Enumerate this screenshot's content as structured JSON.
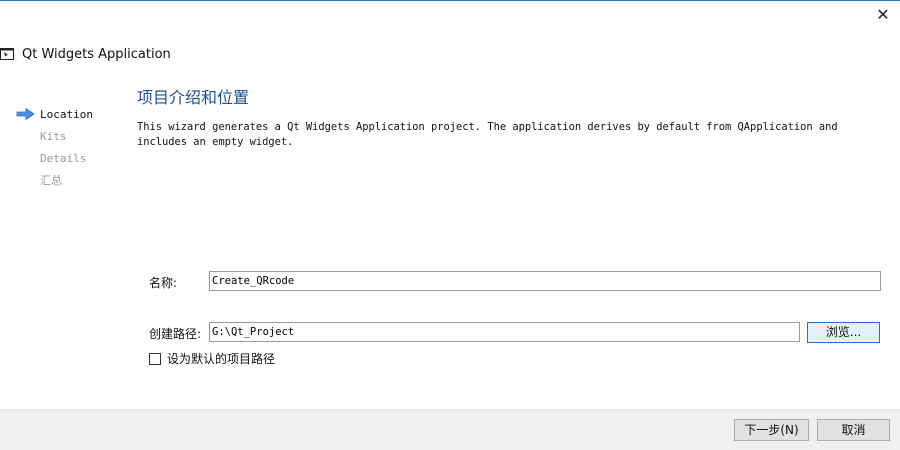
{
  "window": {
    "close_glyph": "✕"
  },
  "header": {
    "title": "Qt Widgets Application",
    "icon": "qt-app-icon"
  },
  "steps": [
    {
      "label": "Location",
      "active": true
    },
    {
      "label": "Kits",
      "active": false
    },
    {
      "label": "Details",
      "active": false
    },
    {
      "label": "汇总",
      "active": false
    }
  ],
  "page": {
    "title": "项目介绍和位置",
    "description": "This wizard generates a Qt Widgets Application project. The application derives by default from QApplication and includes an empty widget."
  },
  "form": {
    "name_label": "名称:",
    "name_value": "Create_QRcode",
    "path_label": "创建路径:",
    "path_value": "G:\\Qt_Project",
    "browse_label": "浏览...",
    "default_path_label": "设为默认的项目路径",
    "default_path_checked": false
  },
  "footer": {
    "next_label": "下一步(N)",
    "cancel_label": "取消"
  },
  "colors": {
    "accent": "#2b79c2",
    "title": "#1f4f8f",
    "footer_bg": "#f0f0f0"
  }
}
